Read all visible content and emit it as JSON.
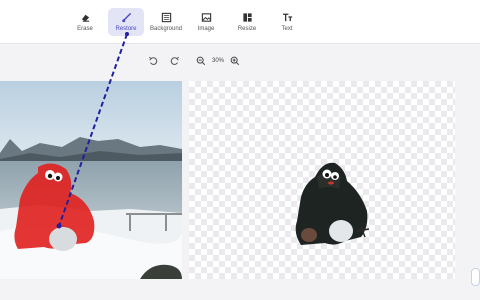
{
  "toolbar": {
    "tools": [
      {
        "label": "Erase",
        "icon": "eraser-icon"
      },
      {
        "label": "Restore",
        "icon": "brush-icon",
        "active": true
      },
      {
        "label": "Background",
        "icon": "background-icon"
      },
      {
        "label": "Image",
        "icon": "image-icon"
      },
      {
        "label": "Resize",
        "icon": "resize-icon"
      },
      {
        "label": "Text",
        "icon": "text-icon"
      }
    ]
  },
  "zoom": {
    "level": "30%"
  },
  "colors": {
    "accent": "#4a47c9",
    "active_bg": "#e4e4f7",
    "mask": "#e0201e",
    "stroke": "#2020a0"
  }
}
